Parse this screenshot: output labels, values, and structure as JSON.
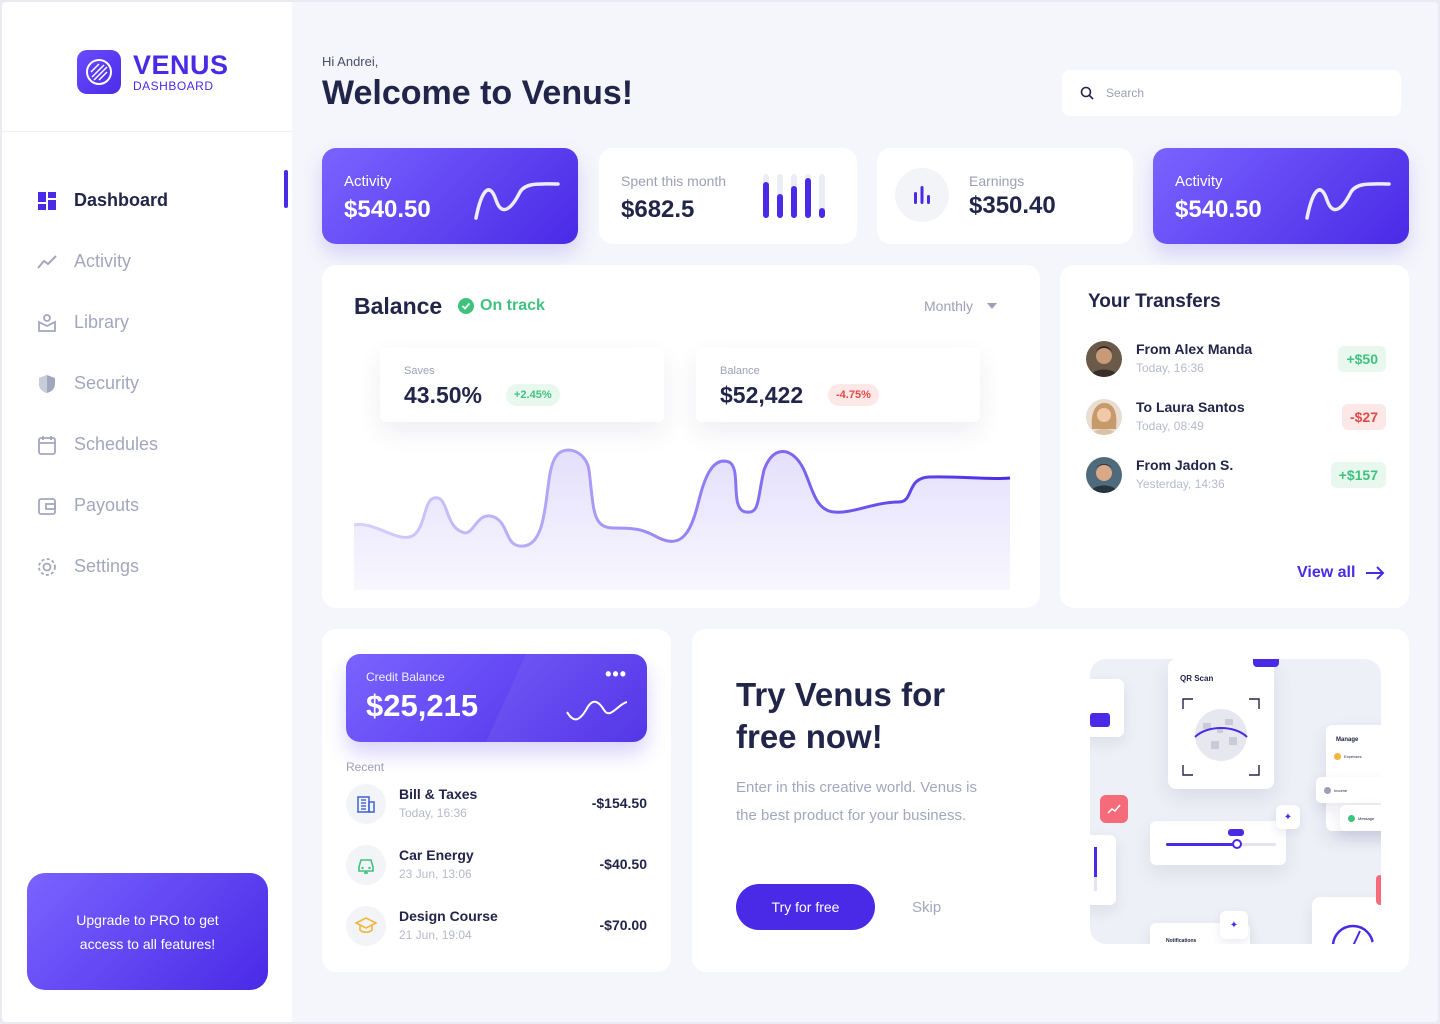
{
  "brand": {
    "name": "VENUS",
    "subtitle": "DASHBOARD"
  },
  "sidebar": {
    "items": [
      {
        "label": "Dashboard",
        "icon": "dashboard-icon",
        "active": true
      },
      {
        "label": "Activity",
        "icon": "activity-icon"
      },
      {
        "label": "Library",
        "icon": "library-icon"
      },
      {
        "label": "Security",
        "icon": "shield-icon"
      },
      {
        "label": "Schedules",
        "icon": "calendar-icon"
      },
      {
        "label": "Payouts",
        "icon": "wallet-icon"
      },
      {
        "label": "Settings",
        "icon": "gear-icon"
      }
    ],
    "upgrade_text": "Upgrade to PRO to get access to all features!"
  },
  "header": {
    "greeting": "Hi Andrei,",
    "title": "Welcome to Venus!",
    "search_placeholder": "Search"
  },
  "stats": [
    {
      "label": "Activity",
      "value": "$540.50"
    },
    {
      "label": "Spent this month",
      "value": "$682.5"
    },
    {
      "label": "Earnings",
      "value": "$350.40"
    },
    {
      "label": "Activity",
      "value": "$540.50"
    }
  ],
  "balance": {
    "title": "Balance",
    "status": "On track",
    "period": "Monthly",
    "saves": {
      "label": "Saves",
      "value": "43.50%",
      "change": "+2.45%"
    },
    "amount": {
      "label": "Balance",
      "value": "$52,422",
      "change": "-4.75%"
    }
  },
  "transfers": {
    "title": "Your Transfers",
    "items": [
      {
        "name": "From Alex Manda",
        "time": "Today, 16:36",
        "amount": "+$50"
      },
      {
        "name": "To Laura Santos",
        "time": "Today, 08:49",
        "amount": "-$27"
      },
      {
        "name": "From Jadon S.",
        "time": "Yesterday, 14:36",
        "amount": "+$157"
      }
    ],
    "view_all": "View all"
  },
  "credit": {
    "label": "Credit Balance",
    "value": "$25,215",
    "menu": "•••",
    "recent_label": "Recent",
    "items": [
      {
        "name": "Bill & Taxes",
        "time": "Today, 16:36",
        "amount": "-$154.50",
        "icon": "building-icon"
      },
      {
        "name": "Car Energy",
        "time": "23 Jun, 13:06",
        "amount": "-$40.50",
        "icon": "car-icon"
      },
      {
        "name": "Design Course",
        "time": "21 Jun, 19:04",
        "amount": "-$70.00",
        "icon": "graduation-cap-icon"
      }
    ]
  },
  "promo": {
    "headline": "Try Venus for free now!",
    "description": "Enter in this creative world. Venus is the best product for your business.",
    "cta": "Try for free",
    "skip": "Skip",
    "illustration": {
      "qr_title": "QR Scan",
      "manage_title": "Manage",
      "manage_items": [
        "Expenses",
        "Income",
        "Message"
      ],
      "notifications_label": "Notifications"
    }
  },
  "colors": {
    "accent": "#4a2ae6",
    "positive": "#3fc27e",
    "negative": "#e24848"
  }
}
